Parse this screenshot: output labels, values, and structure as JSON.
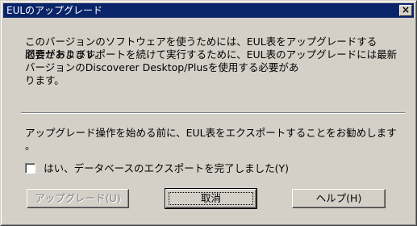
{
  "dialog": {
    "title": "EULのアップグレード",
    "close_label": "×"
  },
  "message": {
    "line1": "このバージョンのソフトウェアを使うためには、EUL表をアップグレードする必要があります。",
    "line2": "問合せおよびレポートを続けて実行するために、EUL表のアップグレードには最新バージョンのDiscoverer Desktop/Plusを使用する必要があります。",
    "line3": "アップグレード操作を始める前に、EUL表をエクスポートすることをお勧めします。"
  },
  "checkbox": {
    "label": "はい、データベースのエクスポートを完了しました(Y)",
    "checked": false
  },
  "buttons": {
    "upgrade": "アップグレード(U)",
    "cancel": "取消",
    "help": "ヘルプ(H)"
  },
  "colors": {
    "title_bar": "#0a246a",
    "face": "#d4d0c8"
  }
}
